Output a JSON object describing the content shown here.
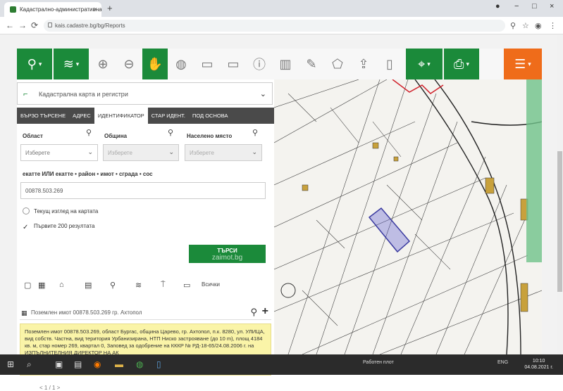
{
  "browser": {
    "tab_title": "Кадастрално-административна ...",
    "tab_close": "×",
    "new_tab": "+",
    "url": "kais.cadastre.bg/bg/Reports",
    "back": "←",
    "forward": "→",
    "reload": "⟳",
    "minimize": "−",
    "restore": "□",
    "close": "×"
  },
  "panel": {
    "title": "Кадастрална карта и регистри",
    "tabs": [
      "БЪРЗО ТЪРСЕНЕ",
      "АДРЕС",
      "ИДЕНТИФИКАТОР",
      "СТАР ИДЕНТ.",
      "ПОД ОСНОВА"
    ],
    "active_tab": 2,
    "labels": {
      "oblast": "Област",
      "obshtina": "Община",
      "naseleno": "Населено място",
      "ekatte": "екатте ИЛИ екатте • район • имот • сграда • сос"
    },
    "oblast_value": "Изберете",
    "obshtina_value": "Изберете",
    "naseleno_value": "Изберете",
    "search_value": "00878.503.269",
    "checkbox_current_view": "Текущ изглед на картата",
    "checkbox_first_200": "Първите 200 резултата",
    "search_button": "ТЪРСИ",
    "search_button_sub": "zaimot.bg",
    "icon_row_extra": "Всички",
    "result_title": "Поземлен имот 00878.503.269 гр. Ахтопол",
    "info_text": "Поземлен имот 00878.503.269, област Бургас, община Царево, гр. Ахтопол, п.к. 8280, ул. УЛИЦА, вид собств. Частна, вид територия Урбанизирана, НТП Ниско застрояване (до 10 m), площ 4184 кв. м, стар номер 269, квартал 0,",
    "info_text2": "Заповед за одобрение на КККР № РД-18-65/24.08.2006 г. на ИЗПЪЛНИТЕЛНИЯ ДИРЕКТОР НА АК",
    "pager": "< 1 / 1 >"
  },
  "taskbar": {
    "start": "⊞",
    "search": "⌕",
    "desktop_label": "Работен плот",
    "lang": "ENG",
    "time": "10:10",
    "date": "04.08.2021 г."
  },
  "colors": {
    "green": "#1b8a3a",
    "orange": "#ef6c1a",
    "highlight": "#faf4a8",
    "parcel": "#5a5ad0"
  }
}
